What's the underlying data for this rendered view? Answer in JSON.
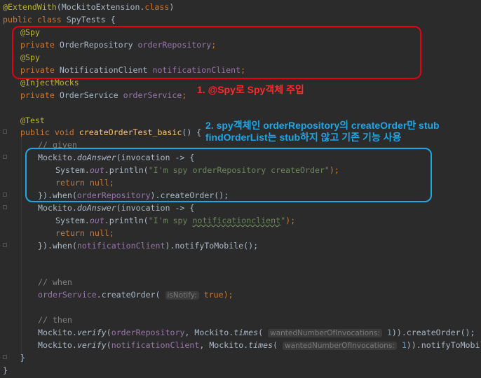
{
  "code": {
    "l1_ann": "@ExtendWith",
    "l1_rest": "(MockitoExtension.",
    "l1_class": "class",
    "l1_end": ")",
    "l2_kw": "public class ",
    "l2_name": "SpyTests {",
    "spy1": "@Spy",
    "l4_kw": "private ",
    "l4_type": "OrderRepository ",
    "l4_field": "orderRepository",
    "l4_end": ";",
    "spy2": "@Spy",
    "l6_kw": "private ",
    "l6_type": "NotificationClient ",
    "l6_field": "notificationClient",
    "l6_end": ";",
    "inject": "@InjectMocks",
    "l8_kw": "private ",
    "l8_type": "OrderService ",
    "l8_field": "orderService",
    "l8_end": ";",
    "test_ann": "@Test",
    "l11_kw": "public void ",
    "l11_fn": "createOrderTest_basic",
    "l11_end": "() {",
    "given": "// given",
    "m1_a": "Mockito.",
    "m1_b": "doAnswer",
    "m1_c": "(invocation -> {",
    "p1_a": "System.",
    "p1_b": "out",
    "p1_c": ".println(",
    "p1_str": "\"I'm spy orderRepository createOrder\"",
    "p1_end": ");",
    "ret1_kw": "return null;",
    "w1_a": "}).when(",
    "w1_field": "orderRepository",
    "w1_b": ").createOrder();",
    "m2_a": "Mockito.",
    "m2_b": "doAnswer",
    "m2_c": "(invocation -> {",
    "p2_a": "System.",
    "p2_b": "out",
    "p2_c": ".println(",
    "p2_str1": "\"I'm spy ",
    "p2_str2": "notificationclient",
    "p2_str3": "\"",
    "p2_end": ");",
    "ret2_kw": "return null;",
    "w2_a": "}).when(",
    "w2_field": "notificationClient",
    "w2_b": ").notifyToMobile();",
    "when": "// when",
    "os_field": "orderService",
    "os_a": ".createOrder(",
    "os_hint": "isNotify:",
    "os_val": "true",
    "os_end": ");",
    "then": "// then",
    "v1_a": "Mockito.",
    "v1_b": "verify",
    "v1_c": "(",
    "v1_field": "orderRepository",
    "v1_d": ", Mockito.",
    "v1_e": "times",
    "v1_f": "(",
    "v1_hint": "wantedNumberOfInvocations:",
    "v1_num": "1",
    "v1_end": ")).createOrder();",
    "v2_a": "Mockito.",
    "v2_b": "verify",
    "v2_c": "(",
    "v2_field": "notificationClient",
    "v2_d": ", Mockito.",
    "v2_e": "times",
    "v2_f": "(",
    "v2_hint": "wantedNumberOfInvocations:",
    "v2_num": "1",
    "v2_end": ")).notifyToMobile();",
    "close1": "}",
    "close2": "}"
  },
  "annotations": {
    "red_note": "1. @Spy로 Spy객체 주입",
    "blue_note_line1": "2. spy객체인 orderRepository의 createOrder만 stub",
    "blue_note_line2": "findOrderList는 stub하지 않고 기존 기능 사용"
  },
  "colors": {
    "background": "#2b2b2b",
    "red_box": "#e60012",
    "blue_box": "#1ea7e8"
  }
}
